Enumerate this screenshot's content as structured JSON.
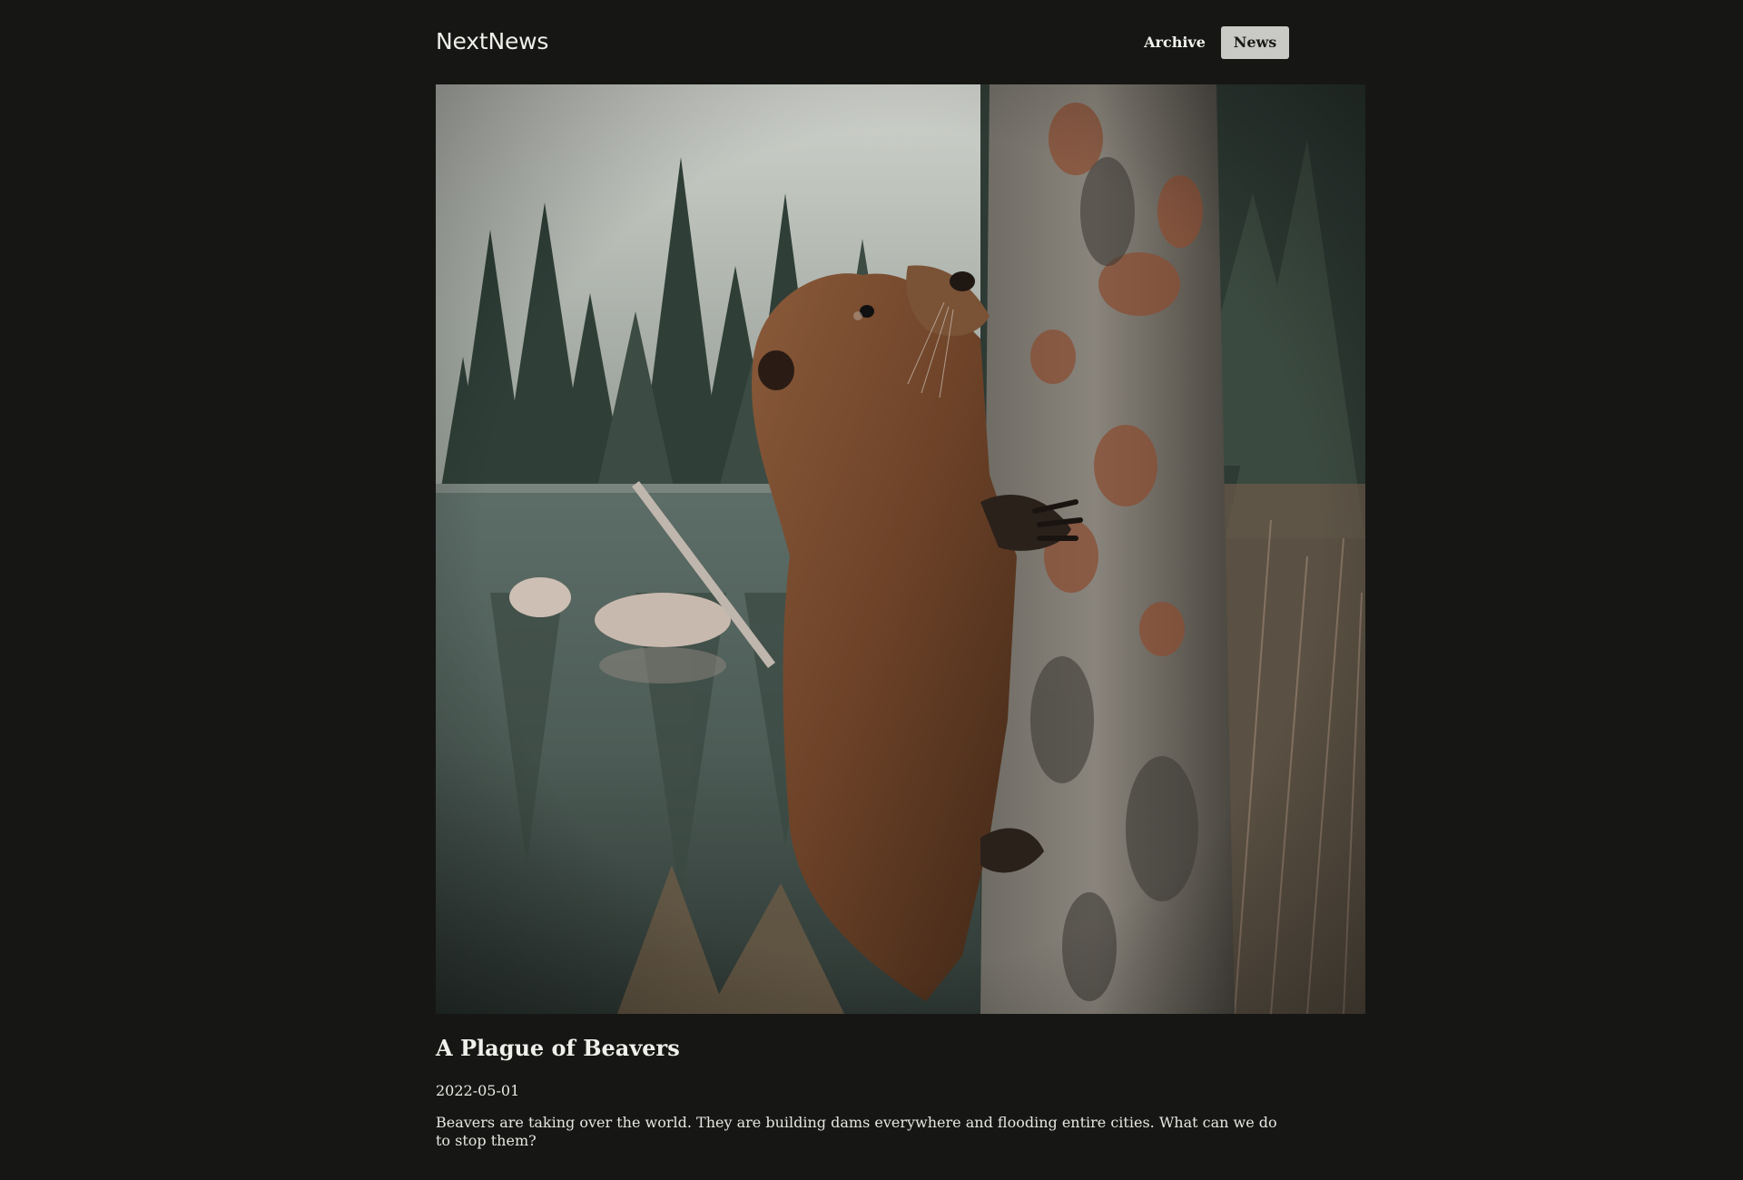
{
  "header": {
    "logo": "NextNews",
    "nav": {
      "archive_label": "Archive",
      "news_label": "News"
    }
  },
  "article": {
    "image_subject": "beaver climbing a tree trunk beside a forest lake",
    "title": "A Plague of Beavers",
    "date": "2022-05-01",
    "summary": "Beavers are taking over the world. They are building dams everywhere and flooding entire cities. What can we do to stop them?"
  },
  "colors": {
    "background": "#161614",
    "active_nav_background": "#c9c9c6",
    "text": "#ededeb"
  }
}
